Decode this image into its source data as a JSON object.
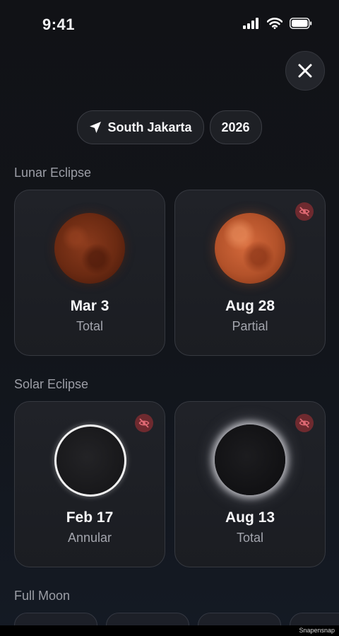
{
  "status": {
    "time": "9:41"
  },
  "filters": {
    "location": "South Jakarta",
    "year": "2026"
  },
  "sections": {
    "lunar": {
      "title": "Lunar Eclipse",
      "cards": [
        {
          "date": "Mar 3",
          "type": "Total",
          "hidden": false
        },
        {
          "date": "Aug 28",
          "type": "Partial",
          "hidden": true
        }
      ]
    },
    "solar": {
      "title": "Solar Eclipse",
      "cards": [
        {
          "date": "Feb 17",
          "type": "Annular",
          "hidden": true
        },
        {
          "date": "Aug 13",
          "type": "Total",
          "hidden": true
        }
      ]
    },
    "fullmoon": {
      "title": "Full Moon"
    }
  },
  "footer": {
    "watermark": "Snapensnap"
  },
  "colors": {
    "background": "#111216",
    "card": "#202228",
    "badge": "#6e2a2f",
    "badge_icon": "#e06a74"
  }
}
